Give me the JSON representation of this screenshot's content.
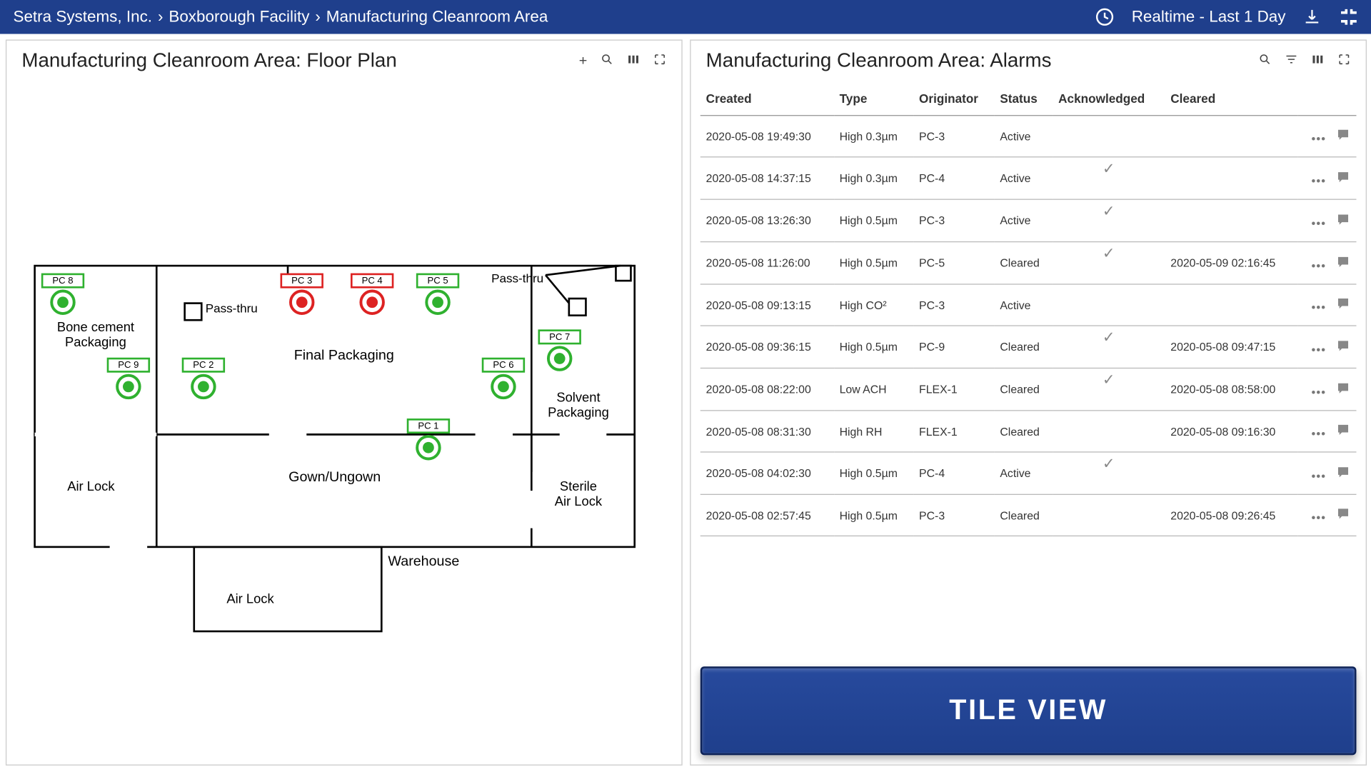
{
  "colors": {
    "brand": "#1f3f8c",
    "ok": "#2fb12f",
    "alarm": "#d22"
  },
  "topbar": {
    "breadcrumb": [
      "Setra Systems, Inc.",
      "Boxborough Facility",
      "Manufacturing Cleanroom Area"
    ],
    "realtime_label": "Realtime - Last 1 Day"
  },
  "floorplan": {
    "title": "Manufacturing Cleanroom Area: Floor Plan",
    "rooms": {
      "bone_cement": "Bone cement\nPackaging",
      "final_packaging": "Final Packaging",
      "gown": "Gown/Ungown",
      "warehouse": "Warehouse",
      "air_lock_left": "Air Lock",
      "air_lock_bottom": "Air Lock",
      "sterile_air_lock": "Sterile\nAir Lock",
      "solvent": "Solvent\nPackaging",
      "pass_thru_left": "Pass-thru",
      "pass_thru_right": "Pass-thru"
    },
    "sensors": [
      {
        "id": "PC 8",
        "status": "ok"
      },
      {
        "id": "PC 3",
        "status": "alarm"
      },
      {
        "id": "PC 4",
        "status": "alarm"
      },
      {
        "id": "PC 5",
        "status": "ok"
      },
      {
        "id": "PC 9",
        "status": "ok"
      },
      {
        "id": "PC 2",
        "status": "ok"
      },
      {
        "id": "PC 6",
        "status": "ok"
      },
      {
        "id": "PC 7",
        "status": "ok"
      },
      {
        "id": "PC 1",
        "status": "ok"
      }
    ]
  },
  "alarms": {
    "title": "Manufacturing Cleanroom Area: Alarms",
    "columns": [
      "Created",
      "Type",
      "Originator",
      "Status",
      "Acknowledged",
      "Cleared"
    ],
    "rows": [
      {
        "created": "2020-05-08 19:49:30",
        "type": "High 0.3µm",
        "originator": "PC-3",
        "status": "Active",
        "ack": false,
        "cleared": ""
      },
      {
        "created": "2020-05-08 14:37:15",
        "type": "High 0.3µm",
        "originator": "PC-4",
        "status": "Active",
        "ack": true,
        "cleared": ""
      },
      {
        "created": "2020-05-08 13:26:30",
        "type": "High 0.5µm",
        "originator": "PC-3",
        "status": "Active",
        "ack": true,
        "cleared": ""
      },
      {
        "created": "2020-05-08 11:26:00",
        "type": "High 0.5µm",
        "originator": "PC-5",
        "status": "Cleared",
        "ack": true,
        "cleared": "2020-05-09 02:16:45"
      },
      {
        "created": "2020-05-08 09:13:15",
        "type": "High CO²",
        "originator": "PC-3",
        "status": "Active",
        "ack": false,
        "cleared": ""
      },
      {
        "created": "2020-05-08 09:36:15",
        "type": "High 0.5µm",
        "originator": "PC-9",
        "status": "Cleared",
        "ack": true,
        "cleared": "2020-05-08 09:47:15"
      },
      {
        "created": "2020-05-08 08:22:00",
        "type": "Low ACH",
        "originator": "FLEX-1",
        "status": "Cleared",
        "ack": true,
        "cleared": "2020-05-08 08:58:00"
      },
      {
        "created": "2020-05-08 08:31:30",
        "type": "High RH",
        "originator": "FLEX-1",
        "status": "Cleared",
        "ack": false,
        "cleared": "2020-05-08 09:16:30"
      },
      {
        "created": "2020-05-08 04:02:30",
        "type": "High 0.5µm",
        "originator": "PC-4",
        "status": "Active",
        "ack": true,
        "cleared": ""
      },
      {
        "created": "2020-05-08 02:57:45",
        "type": "High 0.5µm",
        "originator": "PC-3",
        "status": "Cleared",
        "ack": false,
        "cleared": "2020-05-08 09:26:45"
      }
    ]
  },
  "tileview_label": "TILE VIEW"
}
